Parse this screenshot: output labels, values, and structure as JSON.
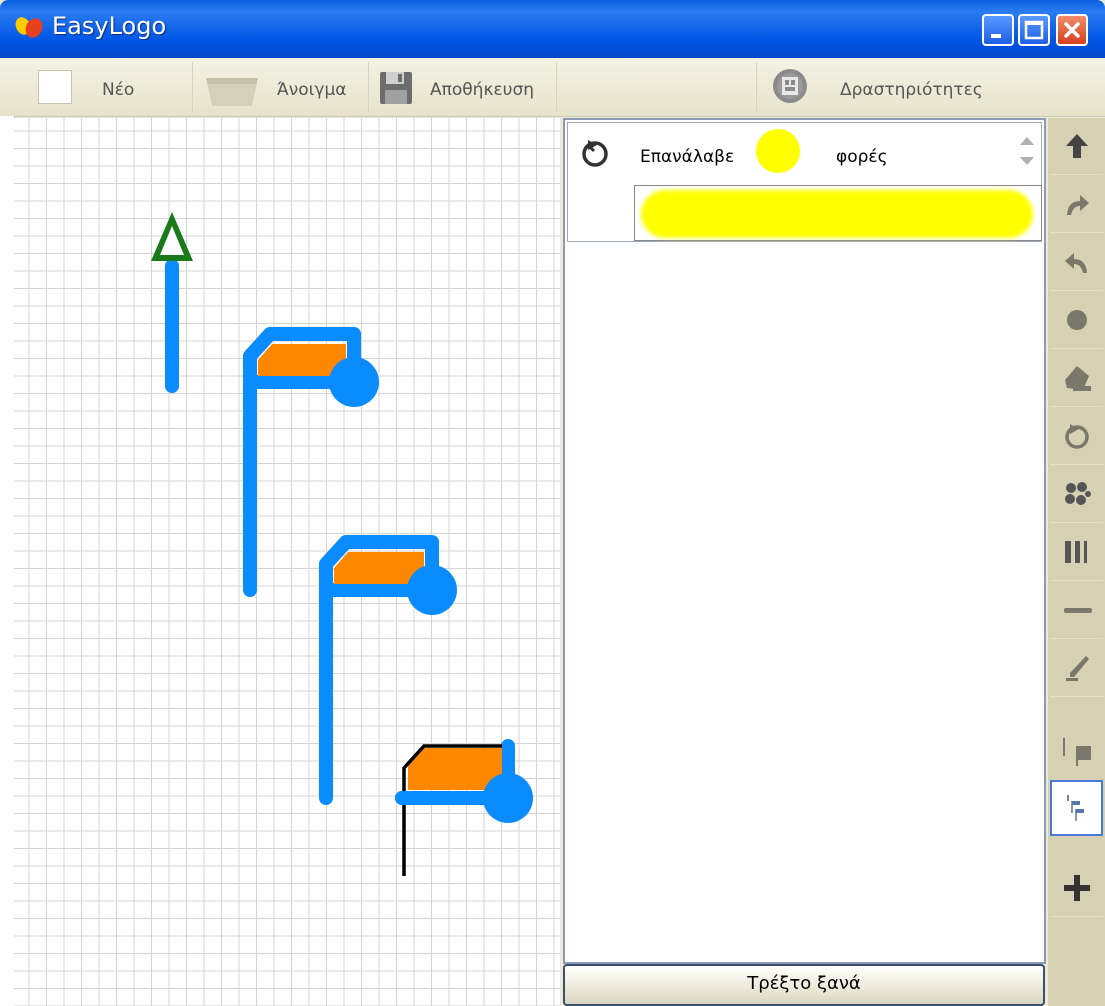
{
  "window": {
    "title": "EasyLogo"
  },
  "toolbar": {
    "new_label": "Νέο",
    "open_label": "Άνοιγμα",
    "save_label": "Αποθήκευση",
    "activities_label": "Δραστηριότητες"
  },
  "program": {
    "repeat_label": "Επανάλαβε",
    "repeat_times_label": "φορές"
  },
  "run_again_label": "Τρέξτο ξανά",
  "palette": {
    "icons": [
      "up-arrow-icon",
      "turn-right-icon",
      "turn-left-icon",
      "dot-icon",
      "fill-bucket-icon",
      "repeat-icon",
      "dots-cluster-icon",
      "bars-icon",
      "line-icon",
      "pen-icon",
      "flag-icon",
      "flags-steps-icon",
      "plus-icon"
    ],
    "selected": "flags-steps-icon"
  },
  "colors": {
    "titlebar": "#0055e5",
    "turtle_path": "#0a8cff",
    "flag_fill": "#ff8800",
    "highlight": "#ffff00",
    "turtle": "#1a7a1a"
  }
}
